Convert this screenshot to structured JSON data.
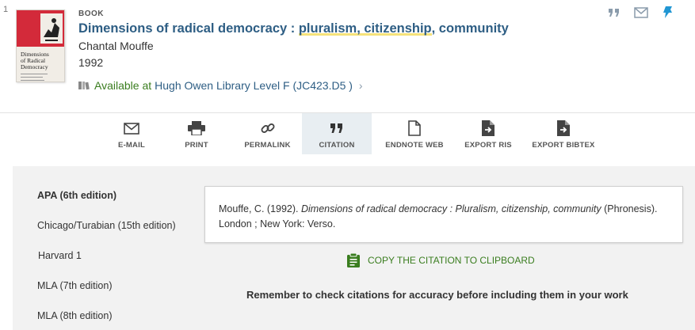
{
  "result": {
    "number": "1",
    "type": "BOOK",
    "title_pre": "Dimensions of radical democracy : ",
    "title_highlight": "pluralism, citizenship",
    "title_post": ", community",
    "author": "Chantal Mouffe",
    "year": "1992",
    "availability_status": "Available at",
    "availability_location": "Hugh Owen Library  Level F (JC423.D5 )",
    "cover": {
      "title_line1": "Dimensions",
      "title_line2": "of Radical",
      "title_line3": "Democracy"
    }
  },
  "top_actions": [
    {
      "name": "citation",
      "icon": "quote-icon"
    },
    {
      "name": "email",
      "icon": "envelope-icon"
    },
    {
      "name": "pin",
      "icon": "pin-icon"
    }
  ],
  "actions": [
    {
      "label": "E-MAIL",
      "icon": "envelope-icon"
    },
    {
      "label": "PRINT",
      "icon": "printer-icon"
    },
    {
      "label": "PERMALINK",
      "icon": "link-icon"
    },
    {
      "label": "CITATION",
      "icon": "quote-icon",
      "active": true
    },
    {
      "label": "ENDNOTE WEB",
      "icon": "file-icon"
    },
    {
      "label": "EXPORT RIS",
      "icon": "export-file-icon"
    },
    {
      "label": "EXPORT BIBTEX",
      "icon": "export-file-icon"
    }
  ],
  "citation": {
    "styles": [
      "APA (6th edition)",
      "Chicago/Turabian (15th edition)",
      "Harvard 1",
      "MLA (7th edition)",
      "MLA (8th edition)"
    ],
    "selected_style": "APA (6th edition)",
    "text_pre": "Mouffe, C. (1992). ",
    "text_italic": "Dimensions of radical democracy : Pluralism, citizenship, community",
    "text_post": " (Phronesis). London ; New York: Verso.",
    "copy_label": "COPY THE CITATION TO CLIPBOARD",
    "reminder": "Remember to check citations for accuracy before including them in your work"
  },
  "colors": {
    "link_blue": "#2e5e84",
    "available_green": "#3a7d1f",
    "highlight_yellow": "#f6e27a",
    "pin_blue": "#2196d3",
    "active_tab_bg": "#e8eef2",
    "panel_bg": "#f2f2f2"
  }
}
